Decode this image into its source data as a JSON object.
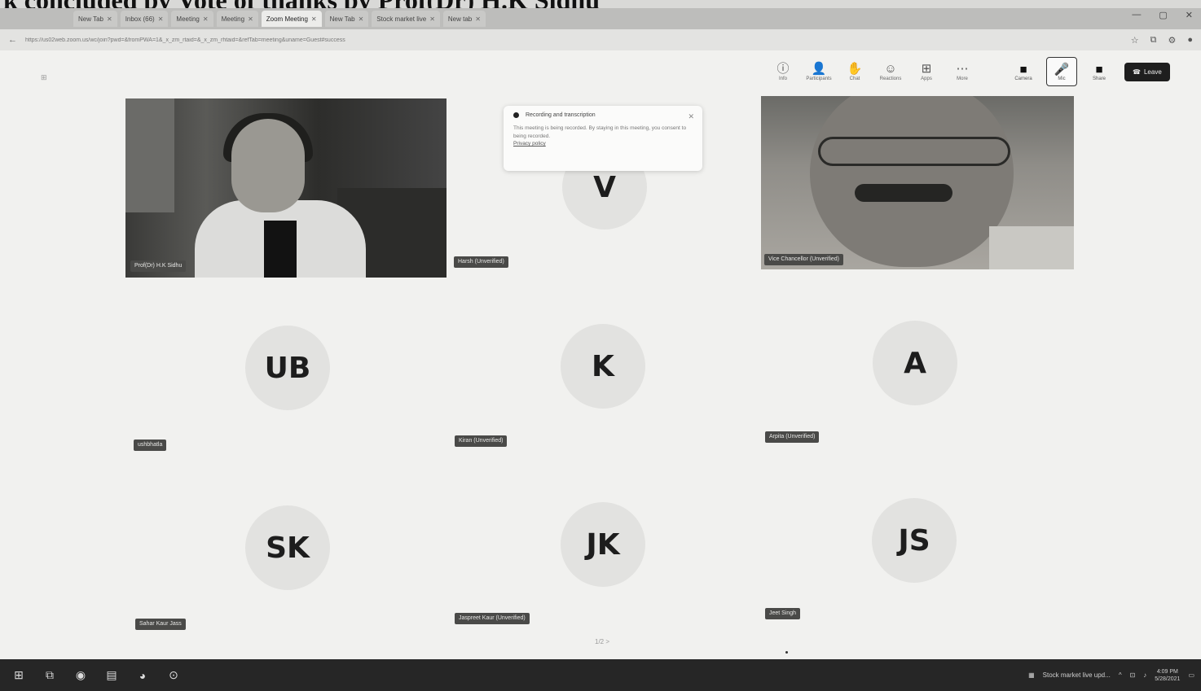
{
  "caption": "k concluded by Vote of thanks by Prof(Dr) H.K Sidhu",
  "browser": {
    "tabs": [
      {
        "label": "New Tab"
      },
      {
        "label": "Inbox (66)"
      },
      {
        "label": "Meeting"
      },
      {
        "label": "Meeting"
      },
      {
        "label": "Zoom Meeting",
        "active": true
      },
      {
        "label": "New Tab"
      },
      {
        "label": "Stock market live"
      },
      {
        "label": "New tab"
      }
    ],
    "address": "https://us02web.zoom.us/wc/join?pwd=&fromPWA=1&_x_zm_rtaid=&_x_zm_rhtaid=&refTab=meeting&uname=Guest#success"
  },
  "zoom": {
    "toolbar": {
      "items": [
        {
          "label": "Info",
          "icon": "info-icon"
        },
        {
          "label": "Participants",
          "icon": "participants-icon"
        },
        {
          "label": "Chat",
          "icon": "chat-icon"
        },
        {
          "label": "Reactions",
          "icon": "reactions-icon"
        },
        {
          "label": "Apps",
          "icon": "apps-icon"
        },
        {
          "label": "More",
          "icon": "more-icon"
        }
      ],
      "camera_label": "Camera",
      "mic_label": "Mic",
      "share_label": "Share",
      "leave_label": "Leave"
    },
    "popup": {
      "title": "Recording and transcription",
      "body": "This meeting is being recorded. By staying in this meeting, you consent to being recorded.",
      "link": "Privacy policy"
    },
    "participants": [
      {
        "name": "Prof(Dr) H.K Sidhu",
        "type": "video"
      },
      {
        "name": "Harsh (Unverified)",
        "initials": "V"
      },
      {
        "name": "Vice Chancellor (Unverified)",
        "type": "video"
      },
      {
        "name": "ushbhatla",
        "initials": "UB"
      },
      {
        "name": "Kiran (Unverified)",
        "initials": "K"
      },
      {
        "name": "Arpita (Unverified)",
        "initials": "A"
      },
      {
        "name": "Sahar Kaur Jass",
        "initials": "SK"
      },
      {
        "name": "Jaspreet Kaur (Unverified)",
        "initials": "JK"
      },
      {
        "name": "Jeet Singh",
        "initials": "JS"
      }
    ],
    "pager": "1/2 >"
  },
  "taskbar": {
    "news": "Stock market live upd...",
    "time": "4:09 PM",
    "date": "5/28/2021"
  }
}
